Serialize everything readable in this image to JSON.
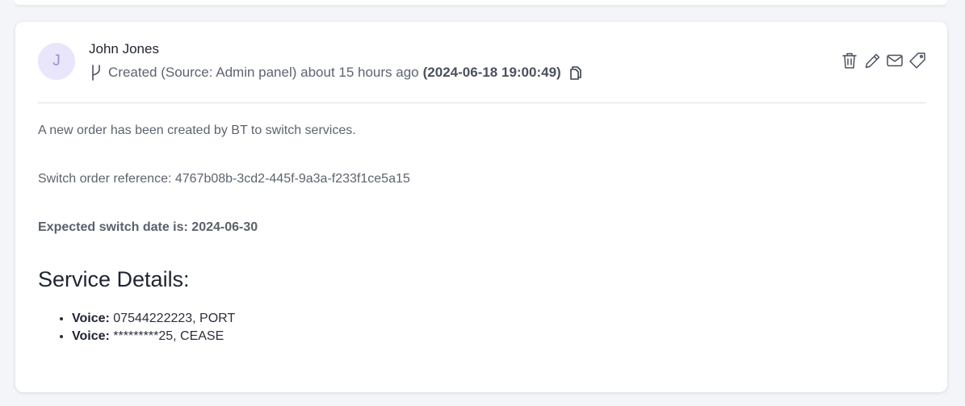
{
  "note": {
    "author": "John Jones",
    "avatar_initial": "J",
    "meta_text": "Created (Source: Admin panel) about 15 hours ago",
    "timestamp": "(2024-06-18 19:00:49)",
    "icons": {
      "branch": "git-branch-icon",
      "copy": "copy-icon"
    },
    "actions": [
      {
        "name": "delete-button",
        "icon": "trash-icon"
      },
      {
        "name": "edit-button",
        "icon": "pencil-icon"
      },
      {
        "name": "email-button",
        "icon": "envelope-icon"
      },
      {
        "name": "tag-button",
        "icon": "tag-icon"
      }
    ],
    "body": {
      "line1": "A new order has been created by BT to switch services.",
      "line2": "Switch order reference: 4767b08b-3cd2-445f-9a3a-f233f1ce5a15",
      "line3_label": "Expected switch date is:",
      "line3_value": "2024-06-30",
      "heading": "Service Details:",
      "services": [
        {
          "label": "Voice:",
          "value": "07544222223, PORT"
        },
        {
          "label": "Voice:",
          "value": "*********25, CEASE"
        }
      ]
    }
  },
  "colors": {
    "avatar_bg": "#e9e5fb",
    "avatar_text": "#9a8fd6",
    "text_muted": "#5d6370",
    "text_dark": "#1f2430"
  }
}
